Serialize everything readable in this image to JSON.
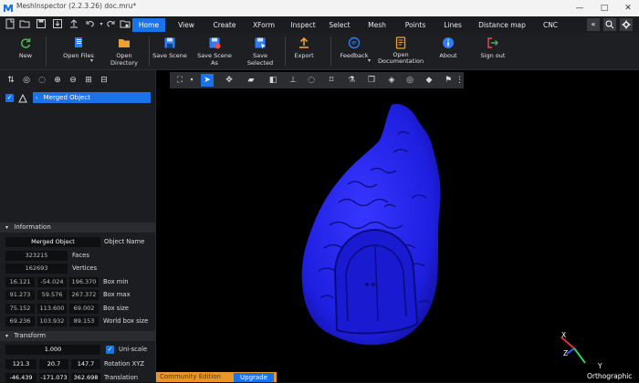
{
  "window": {
    "title": "MeshInspector (2.2.3.26) doc.mru*",
    "minimize": "—",
    "maximize": "□",
    "close": "✕"
  },
  "quickbar": {
    "icons": [
      "new-icon",
      "open-icon",
      "save-icon",
      "export-icon",
      "undo-icon",
      "redo-icon",
      "recent-icon"
    ]
  },
  "tabs": [
    {
      "label": "Home",
      "active": true
    },
    {
      "label": "View"
    },
    {
      "label": "Create"
    },
    {
      "label": "XForm"
    },
    {
      "label": "Inspect"
    },
    {
      "label": "Select"
    },
    {
      "label": "Mesh"
    },
    {
      "label": "Points"
    },
    {
      "label": "Lines"
    },
    {
      "label": "Distance map"
    },
    {
      "label": "CNC"
    }
  ],
  "tab_more": "«",
  "ribbon": {
    "new": "New",
    "open_files": "Open Files",
    "open_directory": "Open Directory",
    "save_scene": "Save Scene",
    "save_scene_as": "Save Scene As",
    "save_selected": "Save Selected",
    "export": "Export",
    "feedback": "Feedback",
    "open_documentation_1": "Open",
    "open_documentation_2": "Documentation",
    "about": "About",
    "sign_out": "Sign out"
  },
  "scene_tree": {
    "item": "Merged Object"
  },
  "information": {
    "header": "Information",
    "object_name_value": "Merged Object",
    "object_name_label": "Object Name",
    "faces_value": "323215",
    "faces_label": "Faces",
    "vertices_value": "162693",
    "vertices_label": "Vertices",
    "box_min": [
      "16.121",
      "-54.024",
      "196.370"
    ],
    "box_min_label": "Box min",
    "box_max": [
      "91.273",
      "59.576",
      "267.372"
    ],
    "box_max_label": "Box max",
    "box_size": [
      "75.152",
      "113.600",
      "69.002"
    ],
    "box_size_label": "Box size",
    "world_box_size": [
      "69.236",
      "103.932",
      "89.153"
    ],
    "world_box_size_label": "World box size"
  },
  "transform": {
    "header": "Transform",
    "scale_value": "1.000",
    "uniscale_label": "Uni-scale",
    "rotation": [
      "121.3",
      "20.7",
      "147.7"
    ],
    "rotation_label": "Rotation XYZ",
    "translation": [
      "-46.439",
      "-171.073",
      "362.698"
    ],
    "translation_label": "Translation"
  },
  "viewport": {
    "axis_x": "X",
    "axis_y": "Y",
    "axis_z": "Z",
    "projection": "Orthographic",
    "mesh_color": "#1f1fe0"
  },
  "bottom": {
    "edition": "Community Edition",
    "upgrade": "Upgrade"
  },
  "colors": {
    "accent": "#1a73e8",
    "edition_badge": "#e8962a"
  }
}
